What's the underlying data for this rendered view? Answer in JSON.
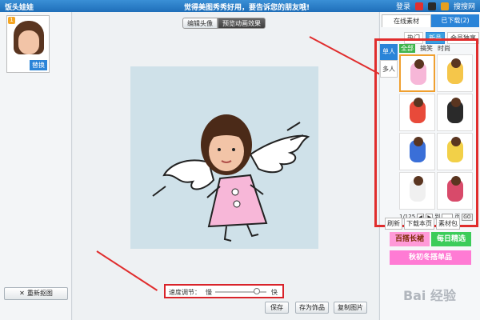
{
  "titlebar": {
    "app_title": "饭头娃娃",
    "slogan": "觉得美图秀秀好用，要告诉您的朋友哦!",
    "login": "登录",
    "search_icon_label": "搜索",
    "feedback": "搜搜网"
  },
  "left": {
    "replace_badge": "替换",
    "badge_num": "1",
    "recrop_label": "重新抠图"
  },
  "center": {
    "tabs": [
      {
        "label": "编辑头像"
      },
      {
        "label": "预览动画效果"
      }
    ],
    "speed": {
      "label": "速度调节：",
      "slow": "慢",
      "fast": "快",
      "value": 0.8
    },
    "buttons": {
      "save": "保存",
      "save_as_gift": "存为饰品",
      "copy_image": "复制图片"
    }
  },
  "right": {
    "tabs": [
      {
        "label": "在线素材"
      },
      {
        "label": "已下载(2)"
      }
    ],
    "subtabs": [
      {
        "label": "热门"
      },
      {
        "label": "新品"
      },
      {
        "label": "会员独享"
      }
    ],
    "side_tabs": [
      {
        "label": "单人"
      },
      {
        "label": "多人"
      }
    ],
    "filters": [
      {
        "label": "全部"
      },
      {
        "label": "搞笑"
      },
      {
        "label": "时尚"
      }
    ],
    "pager": {
      "current": "1/125",
      "goto": "到",
      "page_unit": "页",
      "go": "GO"
    },
    "tools": [
      {
        "label": "刷新"
      },
      {
        "label": "下载本页"
      },
      {
        "label": "素材包"
      }
    ],
    "promos": [
      {
        "label": "百搭长裙"
      },
      {
        "label": "每日精选"
      },
      {
        "label": "秋初冬搭单品"
      }
    ],
    "colors": {
      "promo_1": "#ff9ad8",
      "promo_2": "#3ccc5a",
      "promo_3": "#ff7bd4"
    }
  },
  "watermark": "Bai 经验"
}
